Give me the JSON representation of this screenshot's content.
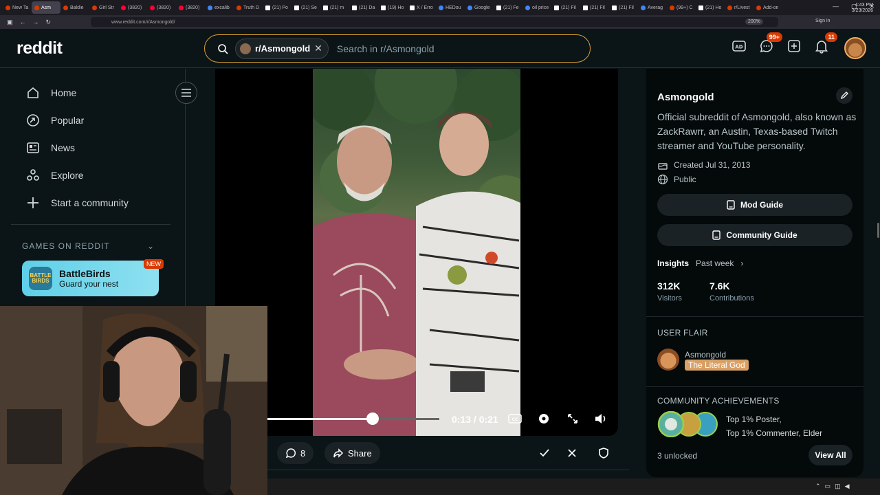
{
  "browser": {
    "tabs": [
      {
        "label": "New Ta",
        "icon": "reddit-icon"
      },
      {
        "label": "Asm",
        "icon": "reddit-icon",
        "active": true
      },
      {
        "label": "Baldie",
        "icon": "reddit-icon"
      },
      {
        "label": "Girl Str",
        "icon": "reddit-icon"
      },
      {
        "label": "(3820)",
        "icon": "youtube-icon"
      },
      {
        "label": "(3820)",
        "icon": "youtube-icon"
      },
      {
        "label": "(3820)",
        "icon": "youtube-icon"
      },
      {
        "label": "excalib",
        "icon": "globe-icon"
      },
      {
        "label": "Truth D",
        "icon": "truth-icon"
      },
      {
        "label": "(21) Po",
        "icon": "x-icon"
      },
      {
        "label": "(21) Se",
        "icon": "x-icon"
      },
      {
        "label": "(21) m",
        "icon": "x-icon"
      },
      {
        "label": "(21) Da",
        "icon": "x-icon"
      },
      {
        "label": "(19) Ho",
        "icon": "x-icon"
      },
      {
        "label": "X / Erro",
        "icon": "x-icon"
      },
      {
        "label": "HEDou",
        "icon": "globe-icon"
      },
      {
        "label": "Google",
        "icon": "google-icon"
      },
      {
        "label": "(21) Fe",
        "icon": "x-icon"
      },
      {
        "label": "oil price",
        "icon": "google-icon"
      },
      {
        "label": "(21) Fil",
        "icon": "x-icon"
      },
      {
        "label": "(21) Fil",
        "icon": "x-icon"
      },
      {
        "label": "(21) Fil",
        "icon": "x-icon"
      },
      {
        "label": "Averag",
        "icon": "globe-icon"
      },
      {
        "label": "(99+) C",
        "icon": "twitch-icon"
      },
      {
        "label": "(21) Ho",
        "icon": "x-icon"
      },
      {
        "label": "r/Livest",
        "icon": "reddit-icon"
      },
      {
        "label": "Add-on",
        "icon": "puzzle-icon"
      }
    ],
    "url": "www.reddit.com/r/Asmongold/",
    "zoom": "200%",
    "sign_in": "Sign in"
  },
  "header": {
    "logo": "reddit",
    "search_chip": "r/Asmongold",
    "search_placeholder": "Search in r/Asmongold",
    "chat_badge": "99+",
    "notif_badge": "11"
  },
  "sidebar": {
    "items": [
      {
        "label": "Home",
        "icon": "home-icon"
      },
      {
        "label": "Popular",
        "icon": "popular-icon"
      },
      {
        "label": "News",
        "icon": "news-icon"
      },
      {
        "label": "Explore",
        "icon": "explore-icon"
      },
      {
        "label": "Start a community",
        "icon": "plus-icon"
      }
    ],
    "games_heading": "GAMES ON REDDIT",
    "game": {
      "title": "BattleBirds",
      "subtitle": "Guard your nest",
      "badge": "NEW",
      "icon_text": "BATTLE BIRDS"
    }
  },
  "video": {
    "time": "0:13 / 0:21",
    "progress": 0.62
  },
  "post_actions": {
    "comments": "8",
    "share": "Share"
  },
  "community": {
    "name": "Asmongold",
    "description": "Official subreddit of Asmongold, also known as ZackRawrr, an Austin, Texas-based Twitch streamer and YouTube personality.",
    "created": "Created Jul 31, 2013",
    "visibility": "Public",
    "mod_guide": "Mod Guide",
    "community_guide": "Community Guide",
    "insights_label": "Insights",
    "insights_period": "Past week",
    "visitors_value": "312K",
    "visitors_label": "Visitors",
    "contrib_value": "7.6K",
    "contrib_label": "Contributions",
    "user_flair_heading": "USER FLAIR",
    "flair_user": "Asmongold",
    "flair_tag": "The Literal God",
    "achievements_heading": "COMMUNITY ACHIEVEMENTS",
    "achievement_line1": "Top 1% Poster,",
    "achievement_line2": "Top 1% Commenter, Elder",
    "unlocked": "3 unlocked",
    "view_all": "View All"
  },
  "taskbar": {
    "time": "4:43 PM",
    "date": "3/23/2026"
  },
  "colors": {
    "accent_orange": "#d93a00",
    "search_border": "#e0a030",
    "background": "#0b1416"
  }
}
